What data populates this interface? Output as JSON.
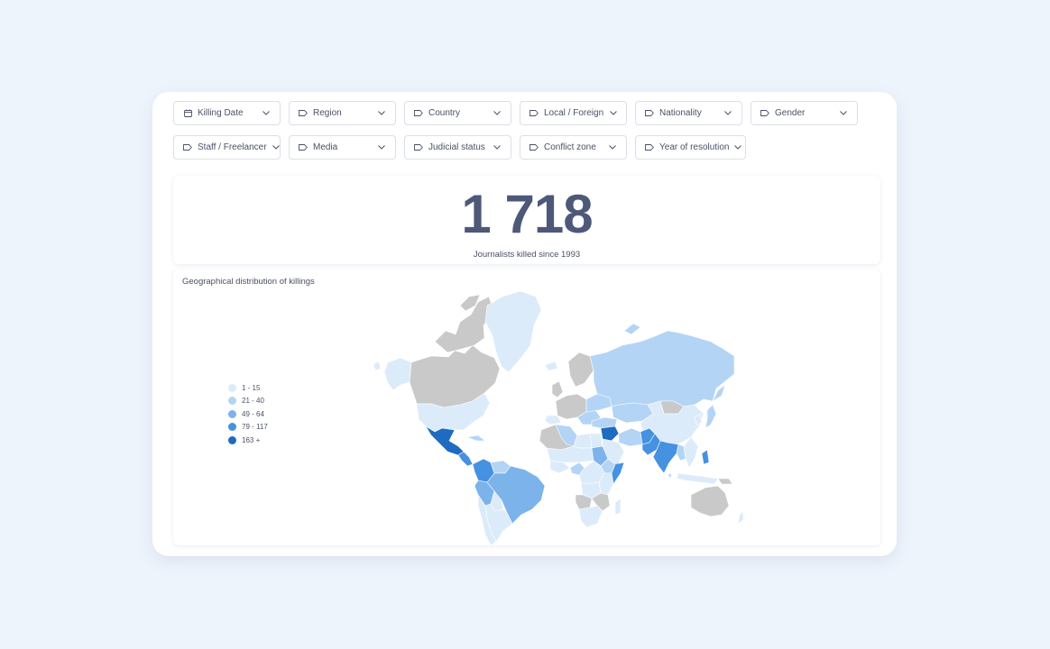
{
  "filters": {
    "row1": [
      {
        "label": "Killing Date",
        "icon": "calendar-icon"
      },
      {
        "label": "Region",
        "icon": "tag-icon"
      },
      {
        "label": "Country",
        "icon": "tag-icon"
      },
      {
        "label": "Local / Foreign",
        "icon": "tag-icon"
      },
      {
        "label": "Nationality",
        "icon": "tag-icon"
      },
      {
        "label": "Gender",
        "icon": "tag-icon"
      }
    ],
    "row2": [
      {
        "label": "Staff / Freelancer",
        "icon": "tag-icon"
      },
      {
        "label": "Media",
        "icon": "tag-icon"
      },
      {
        "label": "Judicial status",
        "icon": "tag-icon"
      },
      {
        "label": "Conflict zone",
        "icon": "tag-icon"
      },
      {
        "label": "Year of resolution",
        "icon": "tag-icon"
      }
    ]
  },
  "kpi": {
    "value": "1 718",
    "label": "Journalists killed since 1993"
  },
  "map": {
    "title": "Geographical distribution of killings",
    "legend": [
      {
        "label": "1 - 15",
        "color": "#dcebfa"
      },
      {
        "label": "21 - 40",
        "color": "#b3d4f5"
      },
      {
        "label": "49 - 64",
        "color": "#7cb3ea"
      },
      {
        "label": "79 - 117",
        "color": "#4691e0"
      },
      {
        "label": "163 +",
        "color": "#1e6bc1"
      }
    ],
    "no_data_color": "#c9c9c9"
  }
}
